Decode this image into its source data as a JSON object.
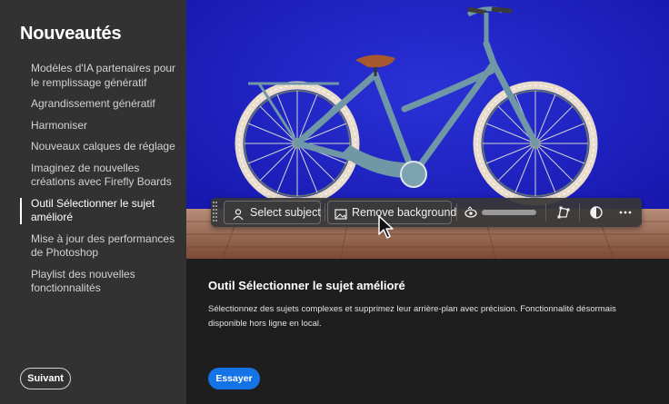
{
  "sidebar": {
    "title": "Nouveautés",
    "items": [
      {
        "label": "Modèles d'IA partenaires pour le remplissage génératif",
        "active": false
      },
      {
        "label": "Agrandissement génératif",
        "active": false
      },
      {
        "label": "Harmoniser",
        "active": false
      },
      {
        "label": "Nouveaux calques de réglage",
        "active": false
      },
      {
        "label": "Imaginez de nouvelles créations avec Firefly Boards",
        "active": false
      },
      {
        "label": "Outil Sélectionner le sujet amélioré",
        "active": true
      },
      {
        "label": "Mise à jour des performances de Photoshop",
        "active": false
      },
      {
        "label": "Playlist des nouvelles fonctionnalités",
        "active": false
      }
    ],
    "next_button": "Suivant"
  },
  "toolbar": {
    "select_subject": "Select subject",
    "remove_background": "Remove background",
    "icons": [
      "person-select-icon",
      "image-icon",
      "mask-icon",
      "transform-icon",
      "adjust-icon",
      "more-icon"
    ]
  },
  "feature": {
    "title": "Outil Sélectionner le sujet amélioré",
    "description": "Sélectionnez des sujets complexes et supprimez leur arrière-plan avec précision. Fonctionnalité désormais disponible hors ligne en local.",
    "cta": "Essayer"
  },
  "colors": {
    "accent": "#1473e6",
    "sidebar_bg": "#323232",
    "main_bg": "#1e1e1e",
    "hero_bg": "#1a1fc4",
    "floor": "#8a5a45"
  }
}
